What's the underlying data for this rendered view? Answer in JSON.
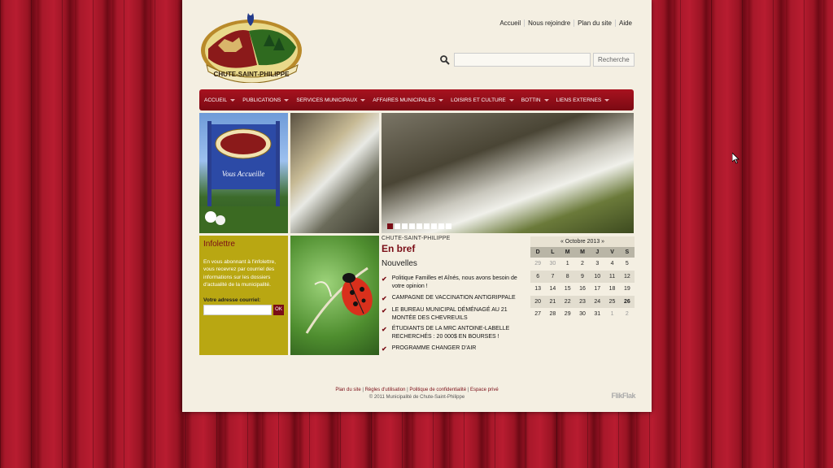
{
  "site": {
    "logo_text": "CHUTE-SAINT-PHILIPPE",
    "sign_text": "Vous Accueille"
  },
  "toplinks": [
    "Accueil",
    "Nous rejoindre",
    "Plan du site",
    "Aide"
  ],
  "search": {
    "button_label": "Recherche",
    "placeholder": ""
  },
  "nav": [
    "ACCUEIL",
    "PUBLICATIONS",
    "SERVICES MUNICIPAUX",
    "AFFAIRES MUNICIPALES",
    "LOISIRS ET CULTURE",
    "BOTTIN",
    "LIENS EXTERNES"
  ],
  "slideshow": {
    "slide_count": 9,
    "active_index": 0
  },
  "infolettre": {
    "title": "Infolettre",
    "text": "En vous abonnant à l'infolettre, vous recevrez par courriel des informations sur les dossiers d'actualité de la municipalité.",
    "email_label": "Votre adresse courriel:",
    "button_label": "OK"
  },
  "news": {
    "kicker": "CHUTE-SAINT-PHILIPPE",
    "title": "En bref",
    "subtitle": "Nouvelles",
    "items": [
      "Politique Familles et Aînés, nous avons besoin de votre opinion !",
      "CAMPAGNE DE VACCINATION ANTIGRIPPALE",
      "LE BUREAU MUNICIPAL DÉMÉNAGÉ AU 21 MONTÉE DES CHEVREUILS",
      "ÉTUDIANTS DE LA MRC ANTOINE-LABELLE RECHERCHÉS : 20 000$ EN BOURSES !",
      "PROGRAMME CHANGER D'AIR"
    ]
  },
  "calendar": {
    "header": "« Octobre 2013 »",
    "days": [
      "D",
      "L",
      "M",
      "M",
      "J",
      "V",
      "S"
    ],
    "weeks": [
      [
        {
          "d": "29",
          "m": true
        },
        {
          "d": "30",
          "m": true
        },
        {
          "d": "1"
        },
        {
          "d": "2"
        },
        {
          "d": "3"
        },
        {
          "d": "4"
        },
        {
          "d": "5"
        }
      ],
      [
        {
          "d": "6"
        },
        {
          "d": "7"
        },
        {
          "d": "8"
        },
        {
          "d": "9"
        },
        {
          "d": "10"
        },
        {
          "d": "11"
        },
        {
          "d": "12"
        }
      ],
      [
        {
          "d": "13"
        },
        {
          "d": "14"
        },
        {
          "d": "15"
        },
        {
          "d": "16"
        },
        {
          "d": "17"
        },
        {
          "d": "18"
        },
        {
          "d": "19"
        }
      ],
      [
        {
          "d": "20"
        },
        {
          "d": "21"
        },
        {
          "d": "22"
        },
        {
          "d": "23"
        },
        {
          "d": "24"
        },
        {
          "d": "25"
        },
        {
          "d": "26",
          "b": true
        }
      ],
      [
        {
          "d": "27"
        },
        {
          "d": "28"
        },
        {
          "d": "29"
        },
        {
          "d": "30"
        },
        {
          "d": "31"
        },
        {
          "d": "1",
          "m": true
        },
        {
          "d": "2",
          "m": true
        }
      ]
    ]
  },
  "footer": {
    "links": [
      "Plan du site",
      "Règles d'utilisation",
      "Politique de confidentialité",
      "Espace privé"
    ],
    "copyright": "© 2011 Municipalité de Chute-Saint-Philippe",
    "credit": "FlikFlak"
  },
  "colors": {
    "brand_red": "#7a0d16",
    "olive": "#b9a712",
    "page_bg": "#f4efe2"
  }
}
